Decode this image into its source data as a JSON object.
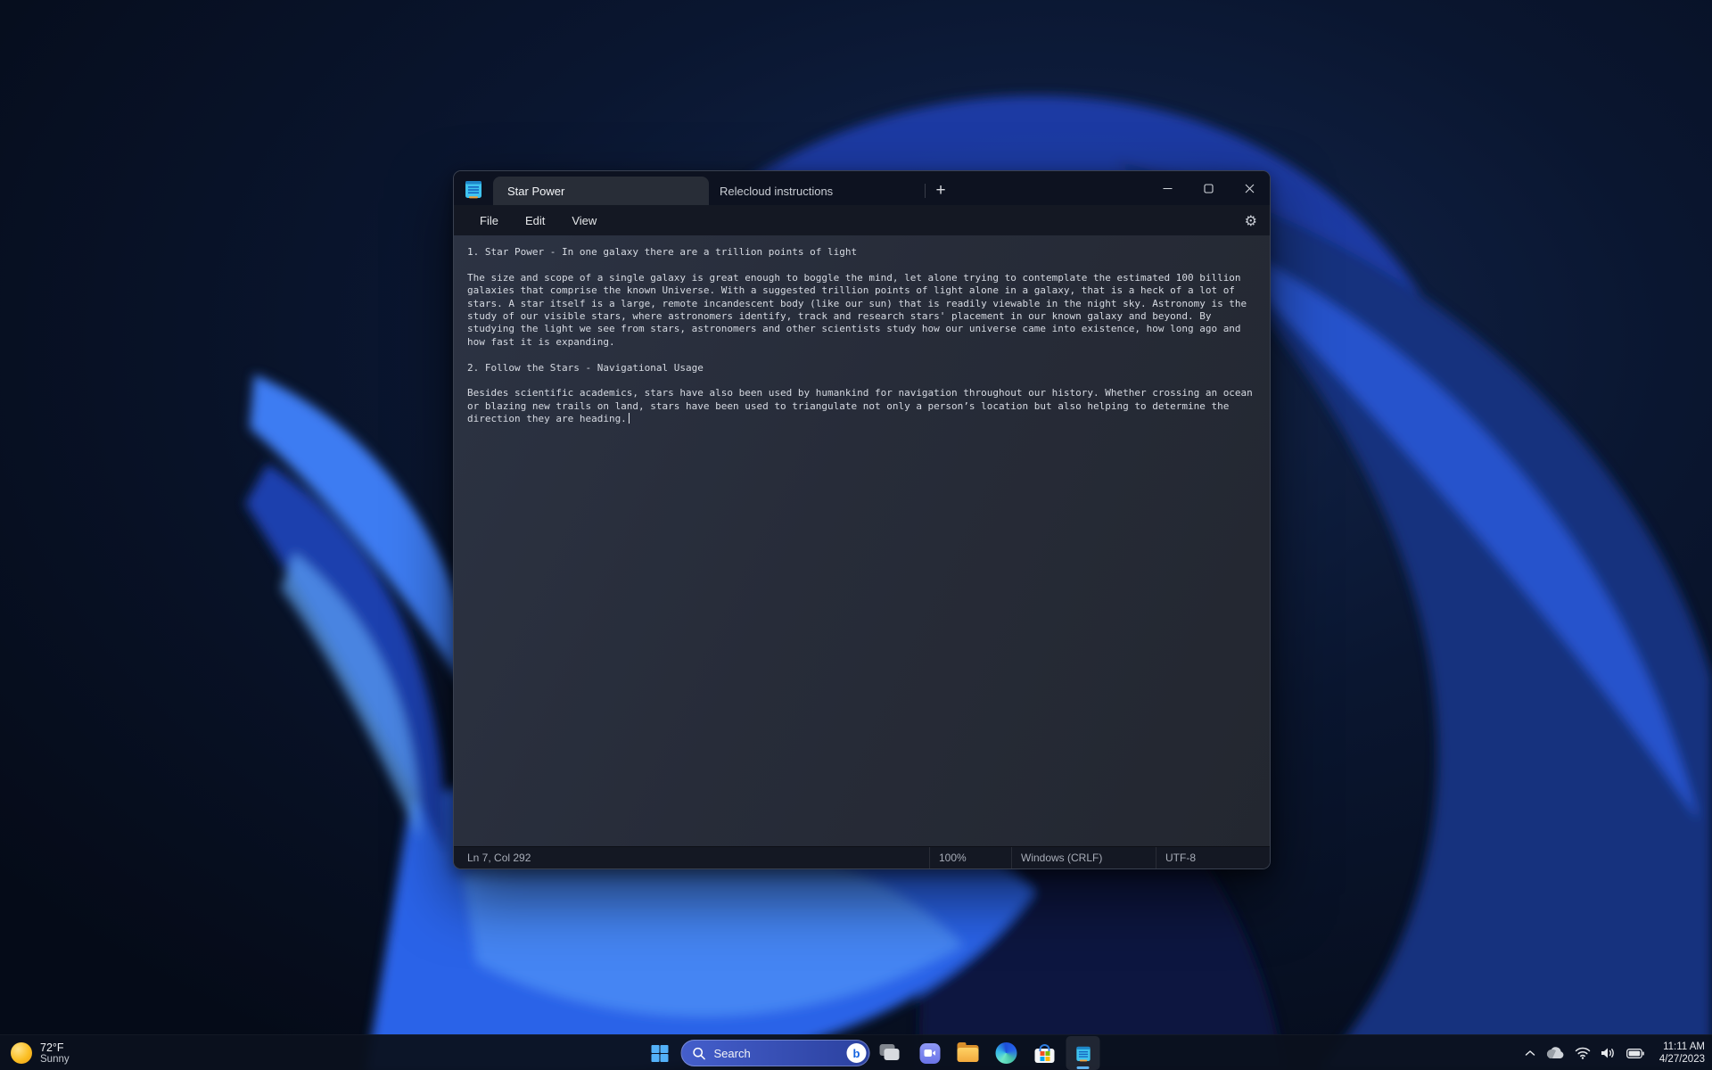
{
  "desktop": {
    "accent_color": "#2563eb",
    "wallpaper": "windows-11-bloom-dark"
  },
  "notepad": {
    "app_icon_name": "notepad-app-icon",
    "tabs": [
      {
        "label": "Star Power",
        "active": true
      },
      {
        "label": "Relecloud instructions",
        "active": false
      }
    ],
    "new_tab_glyph": "+",
    "menu": {
      "items": [
        "File",
        "Edit",
        "View"
      ]
    },
    "settings_glyph": "⚙",
    "editor": {
      "lines": [
        "1. Star Power - In one galaxy there are a trillion points of light",
        "",
        "The size and scope of a single galaxy is great enough to boggle the mind, let alone trying to contemplate the estimated 100 billion",
        "galaxies that comprise the known Universe. With a suggested trillion points of light alone in a galaxy, that is a heck of a lot of",
        "stars. A star itself is a large, remote incandescent body (like our sun) that is readily viewable in the night sky. Astronomy is the",
        "study of our visible stars, where astronomers identify, track and research stars' placement in our known galaxy and beyond. By",
        "studying the light we see from stars, astronomers and other scientists study how our universe came into existence, how long ago and",
        "how fast it is expanding.",
        "",
        "2. Follow the Stars - Navigational Usage",
        "",
        "Besides scientific academics, stars have also been used by humankind for navigation throughout our history. Whether crossing an ocean",
        "or blazing new trails on land, stars have been used to triangulate not only a person’s location but also helping to determine the",
        "direction they are heading."
      ]
    },
    "status": {
      "position": "Ln 7, Col 292",
      "zoom": "100%",
      "line_ending": "Windows (CRLF)",
      "encoding": "UTF-8"
    }
  },
  "taskbar": {
    "weather": {
      "temp": "72°F",
      "condition": "Sunny",
      "icon": "sun-icon"
    },
    "start_icon": "windows-start-icon",
    "search": {
      "label": "Search",
      "icons": [
        "search-icon",
        "bing-icon"
      ]
    },
    "app_icons": [
      "task-view-icon",
      "chat-icon",
      "file-explorer-icon",
      "edge-icon",
      "store-icon",
      "notepad-icon"
    ],
    "active_app": "notepad",
    "tray": {
      "icons": [
        "chevron-up-icon",
        "onedrive-cloud-icon",
        "wifi-icon",
        "volume-icon",
        "battery-icon"
      ],
      "time": "11:11 AM",
      "date": "4/27/2023"
    }
  }
}
